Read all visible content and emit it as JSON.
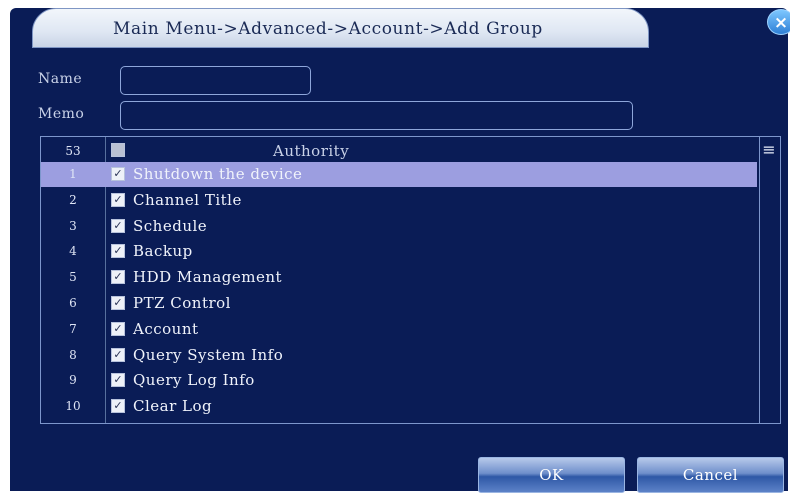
{
  "window": {
    "title": "Main Menu->Advanced->Account->Add Group",
    "close_label": "×"
  },
  "form": {
    "name_label": "Name",
    "name_value": "",
    "memo_label": "Memo",
    "memo_value": ""
  },
  "authority": {
    "count": "53",
    "header": "Authority",
    "scroll_glyph": "≡",
    "items": [
      {
        "num": "1",
        "label": "Shutdown the device",
        "checked": true,
        "selected": true
      },
      {
        "num": "2",
        "label": "Channel Title",
        "checked": true,
        "selected": false
      },
      {
        "num": "3",
        "label": "Schedule",
        "checked": true,
        "selected": false
      },
      {
        "num": "4",
        "label": "Backup",
        "checked": true,
        "selected": false
      },
      {
        "num": "5",
        "label": "HDD Management",
        "checked": true,
        "selected": false
      },
      {
        "num": "6",
        "label": "PTZ Control",
        "checked": true,
        "selected": false
      },
      {
        "num": "7",
        "label": "Account",
        "checked": true,
        "selected": false
      },
      {
        "num": "8",
        "label": "Query System Info",
        "checked": true,
        "selected": false
      },
      {
        "num": "9",
        "label": "Query Log Info",
        "checked": true,
        "selected": false
      },
      {
        "num": "10",
        "label": "Clear Log",
        "checked": true,
        "selected": false
      }
    ]
  },
  "buttons": {
    "ok": "OK",
    "cancel": "Cancel"
  },
  "colors": {
    "background": "#0a1c56",
    "selected_row": "#9c9ee0",
    "field_border": "#8ea6da"
  }
}
